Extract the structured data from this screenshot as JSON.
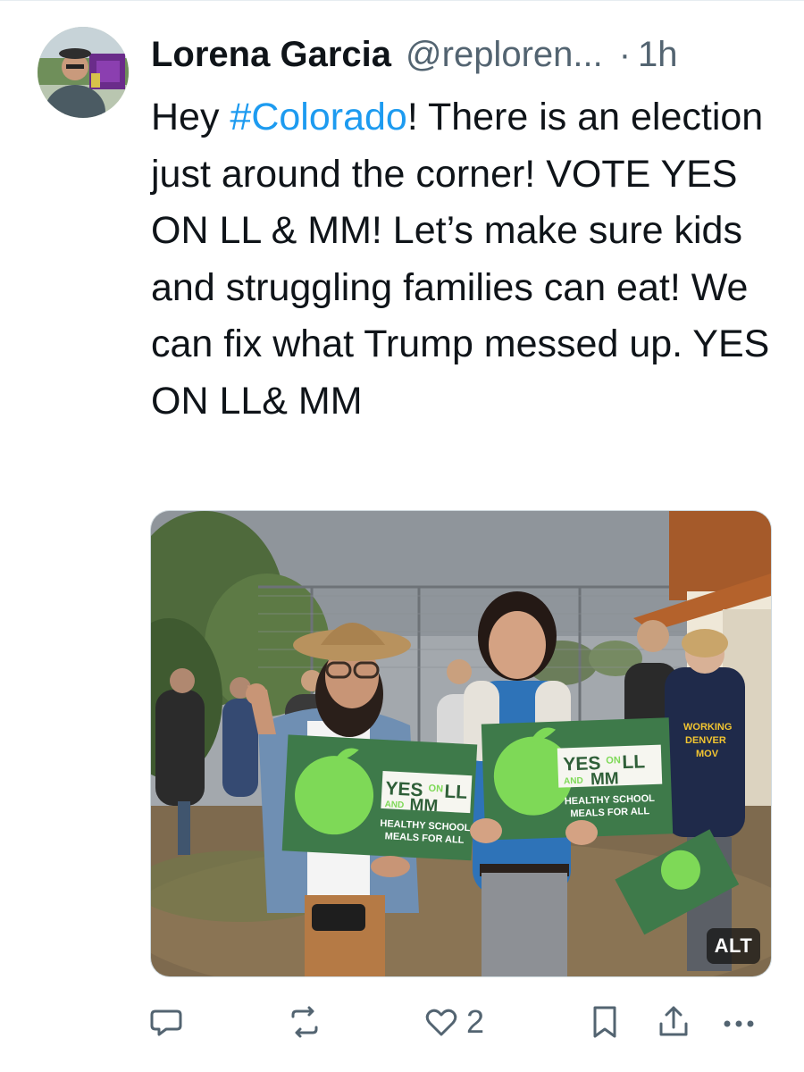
{
  "tweet": {
    "display_name": "Lorena Garcia",
    "handle": "@reploren...",
    "separator": "·",
    "time": "1h",
    "text_parts": {
      "before": "Hey ",
      "hashtag": "#Colorado",
      "after": "! There is an election just around the corner! VOTE YES ON LL & MM! Let’s make sure kids and struggling families can eat! We can fix what Trump messed up. YES ON LL& MM"
    }
  },
  "media": {
    "alt_badge": "ALT",
    "sign_left": {
      "yes": "YES",
      "on": "ON",
      "ll": "LL",
      "and": "AND",
      "mm": "MM",
      "line1": "HEALTHY SCHOOL",
      "line2": "MEALS FOR ALL"
    },
    "sign_right": {
      "yes": "YES",
      "on": "ON",
      "ll": "LL",
      "and": "AND",
      "mm": "MM",
      "line1": "HEALTHY SCHOOL",
      "line2": "MEALS FOR ALL"
    },
    "shirt_text": [
      "WORKING",
      "DENVER",
      "MOV"
    ],
    "colors": {
      "sign_green": "#3e7a4a",
      "apple_green": "#7ed957",
      "sky": "#9aa0a6"
    }
  },
  "actions": {
    "reply": {
      "icon": "reply-icon",
      "count": ""
    },
    "retweet": {
      "icon": "retweet-icon",
      "count": ""
    },
    "like": {
      "icon": "heart-icon",
      "count": "2"
    },
    "bookmark": {
      "icon": "bookmark-icon",
      "count": ""
    },
    "share": {
      "icon": "share-icon",
      "count": ""
    },
    "more": {
      "icon": "more-icon",
      "count": ""
    }
  },
  "colors": {
    "text": "#0f1419",
    "secondary": "#536471",
    "link": "#1d9bf0"
  }
}
